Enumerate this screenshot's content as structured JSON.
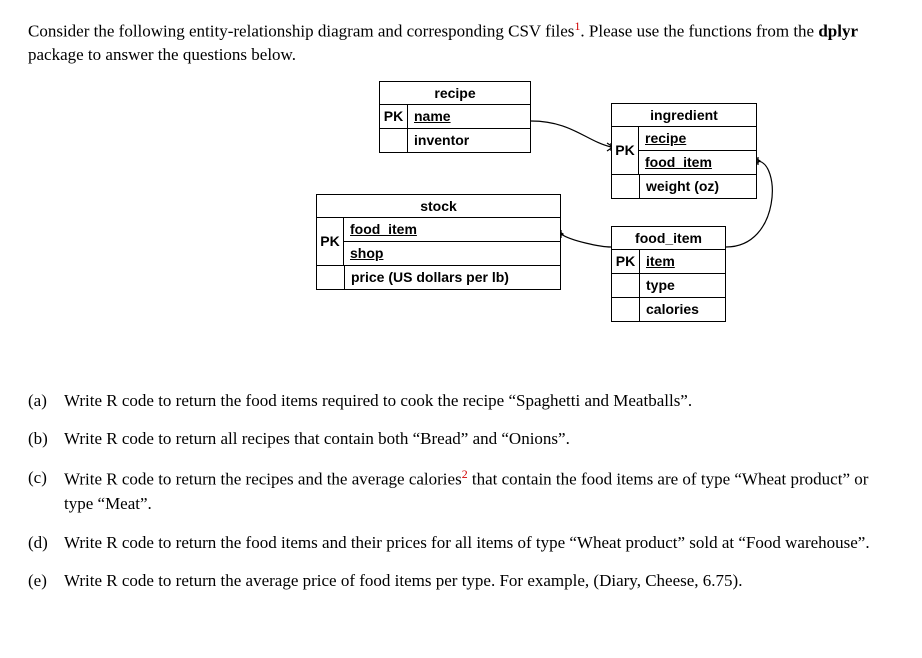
{
  "intro": {
    "line1_a": "Consider the following entity-relationship diagram and corresponding CSV files",
    "ref1": "1",
    "line1_b": ". Please use the",
    "line2_a": "functions from the ",
    "bold": "dplyr",
    "line2_b": " package to answer the questions below."
  },
  "entities": {
    "recipe": {
      "title": "recipe",
      "pk": "PK",
      "attr1": "name",
      "attr2": "inventor"
    },
    "ingredient": {
      "title": "ingredient",
      "pk": "PK",
      "attr1": "recipe",
      "attr2": "food_item",
      "attr3": "weight (oz)"
    },
    "stock": {
      "title": "stock",
      "pk": "PK",
      "attr1": "food_item",
      "attr2": "shop",
      "attr3": "price (US dollars per lb)"
    },
    "food_item": {
      "title": "food_item",
      "pk": "PK",
      "attr1": "item",
      "attr2": "type",
      "attr3": "calories"
    }
  },
  "questions": {
    "a": {
      "label": "(a)",
      "text": "Write R code to return the food items required to cook the recipe “Spaghetti and Meatballs”."
    },
    "b": {
      "label": "(b)",
      "text": "Write R code to return all recipes that contain both “Bread” and “Onions”."
    },
    "c": {
      "label": "(c)",
      "text_a": "Write R code to return the recipes and the average calories",
      "ref": "2",
      "text_b": " that contain the food items are of type “Wheat product” or type “Meat”."
    },
    "d": {
      "label": "(d)",
      "text": "Write R code to return the food items and their prices for all items of type “Wheat product” sold at “Food warehouse”."
    },
    "e": {
      "label": "(e)",
      "text": "Write R code to return the average price of food items per type. For example, (Diary, Cheese, 6.75)."
    }
  }
}
